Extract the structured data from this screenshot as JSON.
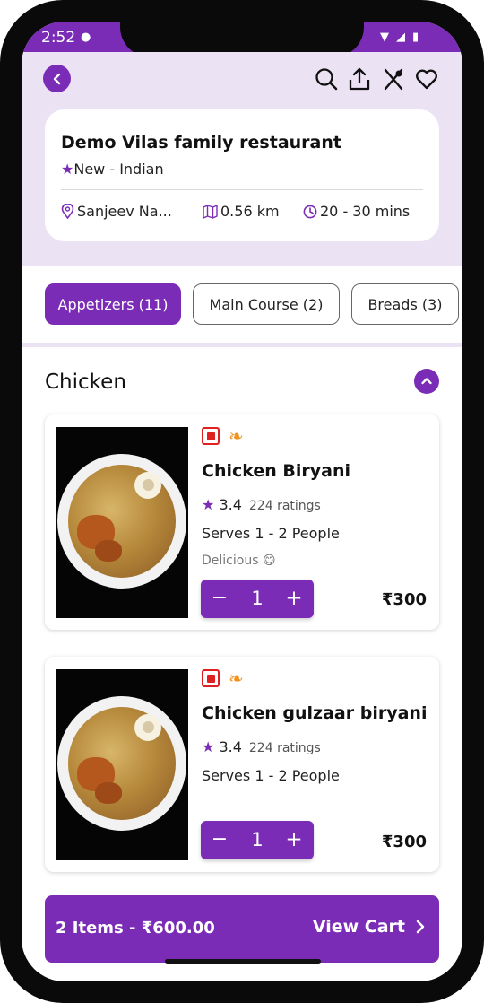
{
  "status_bar": {
    "time": "2:52"
  },
  "header": {
    "restaurant_name": "Demo Vilas family restaurant",
    "badge": "New",
    "cuisine_line": " - Indian",
    "location": "Sanjeev Na...",
    "distance": "0.56 km",
    "delivery_time": "20 - 30 mins"
  },
  "categories": [
    {
      "label": "Appetizers (11)",
      "active": true
    },
    {
      "label": "Main Course (2)",
      "active": false
    },
    {
      "label": "Breads (3)",
      "active": false
    }
  ],
  "section": {
    "title": "Chicken"
  },
  "items": [
    {
      "name": "Chicken Biryani",
      "rating": "3.4",
      "ratings_count": "224 ratings",
      "serves": "Serves 1 - 2 People",
      "description": "Delicious 😋",
      "quantity": "1",
      "price": "₹300"
    },
    {
      "name": "Chicken gulzaar biryani",
      "rating": "3.4",
      "ratings_count": "224 ratings",
      "serves": "Serves 1 - 2 People",
      "description": "",
      "quantity": "1",
      "price": "₹300"
    }
  ],
  "cart": {
    "summary": "2 Items - ₹600.00",
    "action": "View Cart"
  },
  "colors": {
    "accent": "#7b2cb6",
    "header_bg": "#ebe3f4",
    "nonveg": "#e02020"
  }
}
